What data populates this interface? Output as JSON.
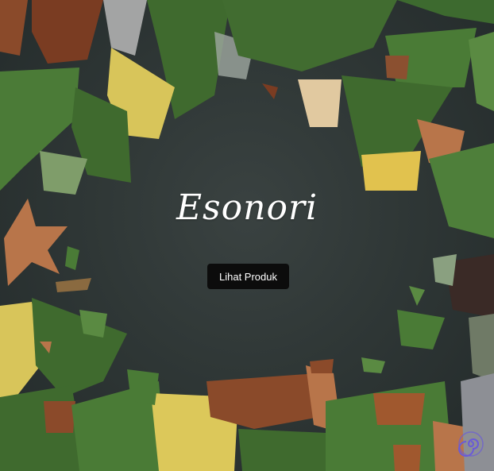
{
  "hero": {
    "brand_name": "Esonori",
    "cta_label": "Lihat Produk",
    "background_image": "flat lay of evergreen sprigs, autumn maple leaves, pine cones and dried flowers framing a dark slate surface"
  },
  "badge": {
    "icon": "spiral-logo-icon",
    "color": "#6a5ad8"
  },
  "colors": {
    "background": "#2f3736",
    "text": "#ffffff",
    "button_bg": "#0c0c0c",
    "foliage_green": "#4e7a3a",
    "foliage_gold": "#d7c45c",
    "leaf_copper": "#b8754a"
  }
}
